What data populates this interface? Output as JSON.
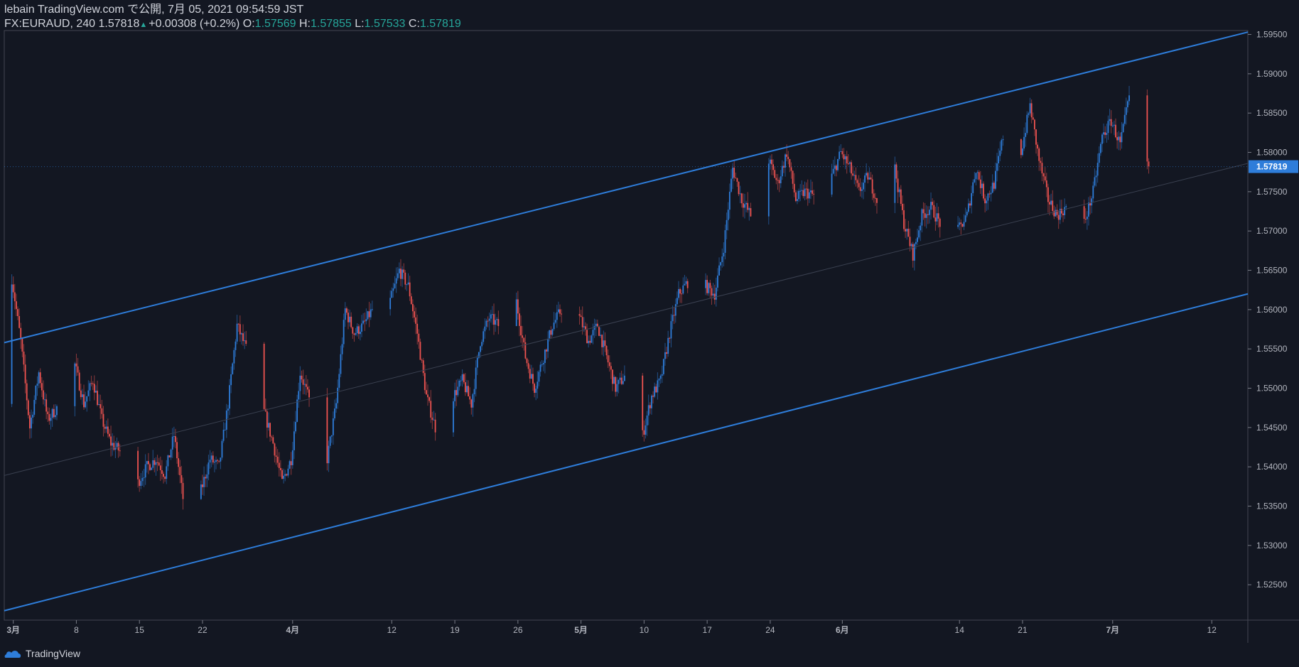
{
  "header": {
    "publish_line": "lebain TradingView.com で公開, 7月 05, 2021 09:54:59 JST",
    "symbol": "FX:EURAUD, 240",
    "last": "1.57818",
    "change": "+0.00308 (+0.2%)",
    "o_label": "O:",
    "o_value": "1.57569",
    "h_label": "H:",
    "h_value": "1.57855",
    "l_label": "L:",
    "l_value": "1.57533",
    "c_label": "C:",
    "c_value": "1.57819"
  },
  "footer": {
    "brand": "TradingView"
  },
  "colors": {
    "background": "#131722",
    "up": "#2e7dda",
    "down": "#ef5350",
    "channel": "#2e7dda",
    "price_tag": "#2e7dda",
    "text": "#d1d4dc"
  },
  "chart_data": {
    "type": "candlestick",
    "timeframe": "240",
    "ylim": [
      1.5205,
      1.5955
    ],
    "y_ticks": [
      1.525,
      1.53,
      1.535,
      1.54,
      1.545,
      1.55,
      1.555,
      1.56,
      1.565,
      1.57,
      1.575,
      1.58,
      1.585,
      1.59,
      1.595
    ],
    "y_tick_labels": [
      "1.52500",
      "1.53000",
      "1.53500",
      "1.54000",
      "1.54500",
      "1.55000",
      "1.55500",
      "1.56000",
      "1.56500",
      "1.57000",
      "1.57500",
      "1.58000",
      "1.58500",
      "1.59000",
      "1.59500"
    ],
    "x_start": "2021-02-28",
    "x_end": "2021-07-16",
    "x_ticks": [
      {
        "date": "2021-03-01",
        "label": "3月"
      },
      {
        "date": "2021-03-08",
        "label": "8"
      },
      {
        "date": "2021-03-15",
        "label": "15"
      },
      {
        "date": "2021-03-22",
        "label": "22"
      },
      {
        "date": "2021-04-01",
        "label": "4月"
      },
      {
        "date": "2021-04-12",
        "label": "12"
      },
      {
        "date": "2021-04-19",
        "label": "19"
      },
      {
        "date": "2021-04-26",
        "label": "26"
      },
      {
        "date": "2021-05-03",
        "label": "5月"
      },
      {
        "date": "2021-05-10",
        "label": "10"
      },
      {
        "date": "2021-05-17",
        "label": "17"
      },
      {
        "date": "2021-05-24",
        "label": "24"
      },
      {
        "date": "2021-06-01",
        "label": "6月"
      },
      {
        "date": "2021-06-14",
        "label": "14"
      },
      {
        "date": "2021-06-21",
        "label": "21"
      },
      {
        "date": "2021-07-01",
        "label": "7月"
      },
      {
        "date": "2021-07-12",
        "label": "12"
      }
    ],
    "last_price": 1.57819,
    "last_price_label": "1.57819",
    "price_path": [
      [
        "2021-02-28",
        1.548
      ],
      [
        "2021-03-01",
        1.564
      ],
      [
        "2021-03-02",
        1.556
      ],
      [
        "2021-03-03",
        1.545
      ],
      [
        "2021-03-04",
        1.552
      ],
      [
        "2021-03-05",
        1.546
      ],
      [
        "2021-03-07",
        1.549
      ],
      [
        "2021-03-08",
        1.553
      ],
      [
        "2021-03-09",
        1.548
      ],
      [
        "2021-03-10",
        1.551
      ],
      [
        "2021-03-11",
        1.546
      ],
      [
        "2021-03-12",
        1.543
      ],
      [
        "2021-03-14",
        1.541
      ],
      [
        "2021-03-15",
        1.538
      ],
      [
        "2021-03-16",
        1.54
      ],
      [
        "2021-03-17",
        1.541
      ],
      [
        "2021-03-18",
        1.539
      ],
      [
        "2021-03-19",
        1.544
      ],
      [
        "2021-03-20",
        1.536
      ],
      [
        "2021-03-21",
        1.528
      ],
      [
        "2021-03-22",
        1.537
      ],
      [
        "2021-03-23",
        1.541
      ],
      [
        "2021-03-24",
        1.54
      ],
      [
        "2021-03-25",
        1.548
      ],
      [
        "2021-03-26",
        1.558
      ],
      [
        "2021-03-28",
        1.552
      ],
      [
        "2021-03-29",
        1.547
      ],
      [
        "2021-03-30",
        1.543
      ],
      [
        "2021-03-31",
        1.538
      ],
      [
        "2021-04-01",
        1.541
      ],
      [
        "2021-04-02",
        1.552
      ],
      [
        "2021-04-04",
        1.545
      ],
      [
        "2021-04-05",
        1.541
      ],
      [
        "2021-04-06",
        1.548
      ],
      [
        "2021-04-07",
        1.56
      ],
      [
        "2021-04-08",
        1.557
      ],
      [
        "2021-04-09",
        1.558
      ],
      [
        "2021-04-11",
        1.562
      ],
      [
        "2021-04-12",
        1.561
      ],
      [
        "2021-04-13",
        1.565
      ],
      [
        "2021-04-14",
        1.563
      ],
      [
        "2021-04-15",
        1.557
      ],
      [
        "2021-04-16",
        1.549
      ],
      [
        "2021-04-17",
        1.545
      ],
      [
        "2021-04-18",
        1.546
      ],
      [
        "2021-04-19",
        1.549
      ],
      [
        "2021-04-20",
        1.551
      ],
      [
        "2021-04-21",
        1.548
      ],
      [
        "2021-04-22",
        1.556
      ],
      [
        "2021-04-23",
        1.559
      ],
      [
        "2021-04-25",
        1.557
      ],
      [
        "2021-04-26",
        1.561
      ],
      [
        "2021-04-27",
        1.554
      ],
      [
        "2021-04-28",
        1.55
      ],
      [
        "2021-04-29",
        1.554
      ],
      [
        "2021-04-30",
        1.558
      ],
      [
        "2021-05-01",
        1.56
      ],
      [
        "2021-05-03",
        1.559
      ],
      [
        "2021-05-04",
        1.556
      ],
      [
        "2021-05-05",
        1.558
      ],
      [
        "2021-05-06",
        1.554
      ],
      [
        "2021-05-07",
        1.55
      ],
      [
        "2021-05-09",
        1.553
      ],
      [
        "2021-05-10",
        1.544
      ],
      [
        "2021-05-11",
        1.549
      ],
      [
        "2021-05-12",
        1.551
      ],
      [
        "2021-05-13",
        1.557
      ],
      [
        "2021-05-14",
        1.562
      ],
      [
        "2021-05-16",
        1.565
      ],
      [
        "2021-05-17",
        1.563
      ],
      [
        "2021-05-18",
        1.562
      ],
      [
        "2021-05-19",
        1.568
      ],
      [
        "2021-05-20",
        1.578
      ],
      [
        "2021-05-21",
        1.574
      ],
      [
        "2021-05-22",
        1.572
      ],
      [
        "2021-05-23",
        1.576
      ],
      [
        "2021-05-24",
        1.579
      ],
      [
        "2021-05-25",
        1.576
      ],
      [
        "2021-05-26",
        1.58
      ],
      [
        "2021-05-27",
        1.574
      ],
      [
        "2021-05-28",
        1.575
      ],
      [
        "2021-05-30",
        1.574
      ],
      [
        "2021-05-31",
        1.577
      ],
      [
        "2021-06-01",
        1.58
      ],
      [
        "2021-06-02",
        1.578
      ],
      [
        "2021-06-03",
        1.575
      ],
      [
        "2021-06-04",
        1.577
      ],
      [
        "2021-06-05",
        1.574
      ],
      [
        "2021-06-06",
        1.583
      ],
      [
        "2021-06-07",
        1.578
      ],
      [
        "2021-06-08",
        1.571
      ],
      [
        "2021-06-09",
        1.567
      ],
      [
        "2021-06-10",
        1.572
      ],
      [
        "2021-06-11",
        1.573
      ],
      [
        "2021-06-12",
        1.571
      ],
      [
        "2021-06-13",
        1.569
      ],
      [
        "2021-06-14",
        1.57
      ],
      [
        "2021-06-15",
        1.572
      ],
      [
        "2021-06-16",
        1.578
      ],
      [
        "2021-06-17",
        1.574
      ],
      [
        "2021-06-18",
        1.576
      ],
      [
        "2021-06-19",
        1.582
      ],
      [
        "2021-06-20",
        1.585
      ],
      [
        "2021-06-21",
        1.58
      ],
      [
        "2021-06-22",
        1.586
      ],
      [
        "2021-06-23",
        1.579
      ],
      [
        "2021-06-24",
        1.574
      ],
      [
        "2021-06-25",
        1.572
      ],
      [
        "2021-06-26",
        1.573
      ],
      [
        "2021-06-27",
        1.572
      ],
      [
        "2021-06-28",
        1.571
      ],
      [
        "2021-06-29",
        1.575
      ],
      [
        "2021-06-30",
        1.582
      ],
      [
        "2021-07-01",
        1.584
      ],
      [
        "2021-07-02",
        1.581
      ],
      [
        "2021-07-03",
        1.587
      ],
      [
        "2021-07-04",
        1.58
      ],
      [
        "2021-07-05",
        1.5782
      ]
    ],
    "lines": [
      {
        "name": "channel-upper",
        "from": [
          "2021-02-28",
          1.5558
        ],
        "to": [
          "2021-07-16",
          1.5953
        ]
      },
      {
        "name": "channel-lower",
        "from": [
          "2021-02-28",
          1.5217
        ],
        "to": [
          "2021-07-16",
          1.562
        ]
      },
      {
        "name": "channel-mid",
        "from": [
          "2021-02-28",
          1.5389
        ],
        "to": [
          "2021-07-16",
          1.5786
        ]
      }
    ]
  }
}
